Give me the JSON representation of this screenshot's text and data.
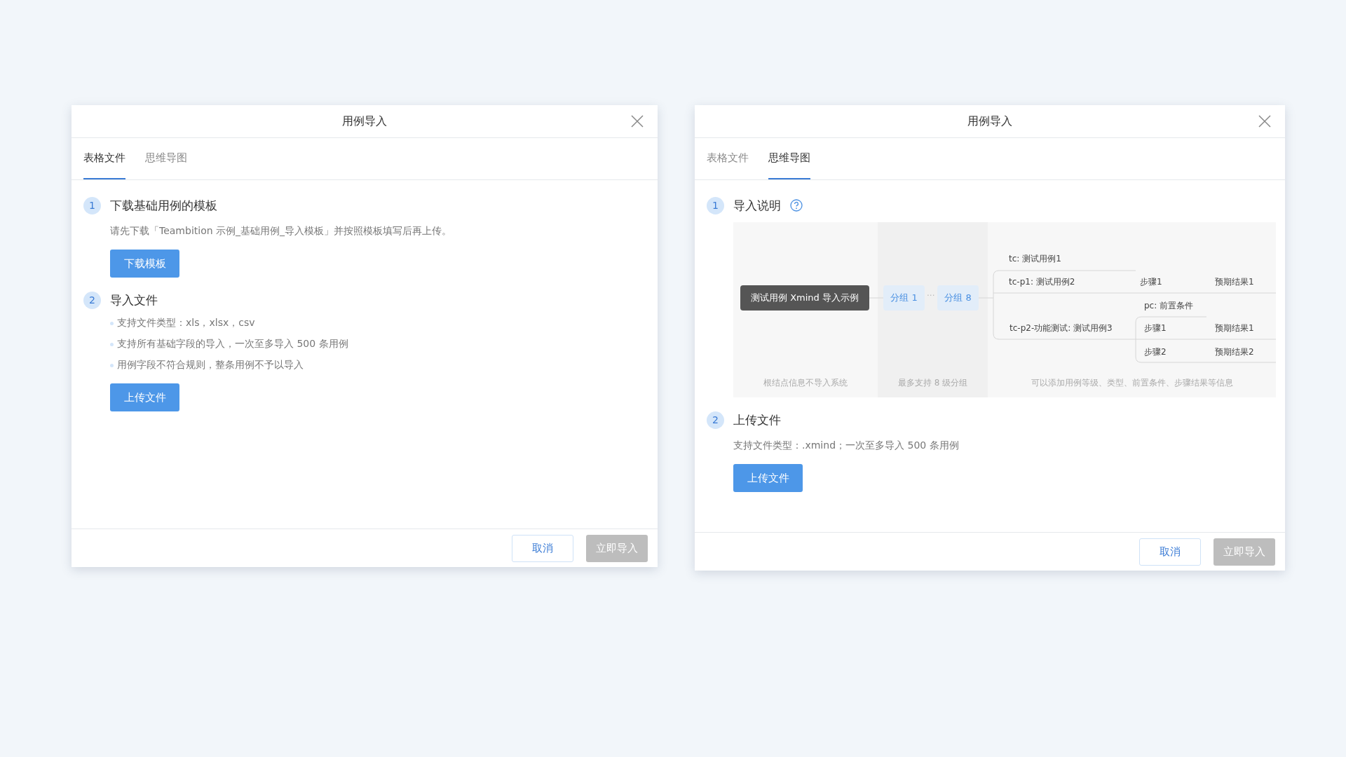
{
  "dialogs": [
    {
      "title": "用例导入",
      "tabs": [
        {
          "label": "表格文件",
          "selected": true
        },
        {
          "label": "思维导图",
          "selected": false
        }
      ],
      "sections": [
        {
          "number": "1",
          "heading": "下载基础用例的模板",
          "description": "请先下载「Teambition 示例_基础用例_导入模板」并按照模板填写后再上传。",
          "button": "下载模板"
        },
        {
          "number": "2",
          "heading": "导入文件",
          "bullets": [
            "支持文件类型：xls，xlsx，csv",
            "支持所有基础字段的导入，一次至多导入 500 条用例",
            "用例字段不符合规则，整条用例不予以导入"
          ],
          "button": "上传文件"
        }
      ],
      "buttons": [
        {
          "label": "取消",
          "disabled": false
        },
        {
          "label": "立即导入",
          "disabled": true
        }
      ]
    },
    {
      "title": "用例导入",
      "tabs": [
        {
          "label": "表格文件",
          "selected": false
        },
        {
          "label": "思维导图",
          "selected": true
        }
      ],
      "sections": [
        {
          "number": "1",
          "heading": "导入说明",
          "help": true,
          "diagram": {
            "root": "测试用例 Xmind 导入示例",
            "groups": [
              "分组 1",
              "分组 8"
            ],
            "separator": "···",
            "nodes": [
              "tc: 测试用例1",
              "tc-p1: 测试用例2",
              "步骤1",
              "预期结果1",
              "pc: 前置条件",
              "tc-p2-功能测试: 测试用例3",
              "步骤1",
              "预期结果1",
              "步骤2",
              "预期结果2"
            ],
            "captions": [
              "根结点信息不导入系统",
              "最多支持 8 级分组",
              "可以添加用例等级、类型、前置条件、步骤结果等信息"
            ]
          }
        },
        {
          "number": "2",
          "heading": "上传文件",
          "description": "支持文件类型：.xmind；一次至多导入 500 条用例",
          "button": "上传文件"
        }
      ],
      "buttons": [
        {
          "label": "取消",
          "disabled": false
        },
        {
          "label": "立即导入",
          "disabled": true
        }
      ]
    }
  ]
}
